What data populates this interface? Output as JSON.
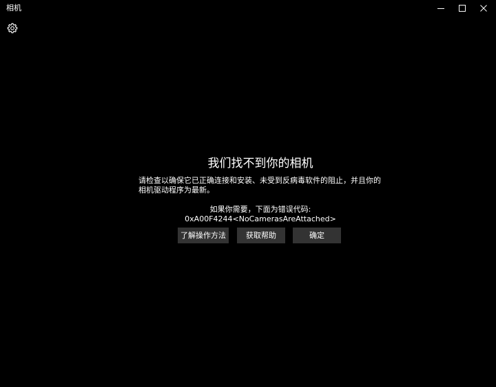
{
  "window": {
    "title": "相机"
  },
  "message": {
    "headline": "我们找不到你的相机",
    "description": "请检查以确保它已正确连接和安装、未受到反病毒软件的阻止，并且你的相机驱动程序为最新。",
    "code_label": "如果你需要，下面为错误代码:",
    "code_value": "0xA00F4244<NoCamerasAreAttached>"
  },
  "actions": {
    "learn_label": "了解操作方法",
    "help_label": "获取帮助",
    "ok_label": "确定"
  },
  "icons": {
    "settings": "gear-icon",
    "minimize": "minimize-icon",
    "maximize": "maximize-icon",
    "close": "close-icon"
  },
  "colors": {
    "background": "#000000",
    "text": "#ffffff",
    "button": "#333333"
  }
}
